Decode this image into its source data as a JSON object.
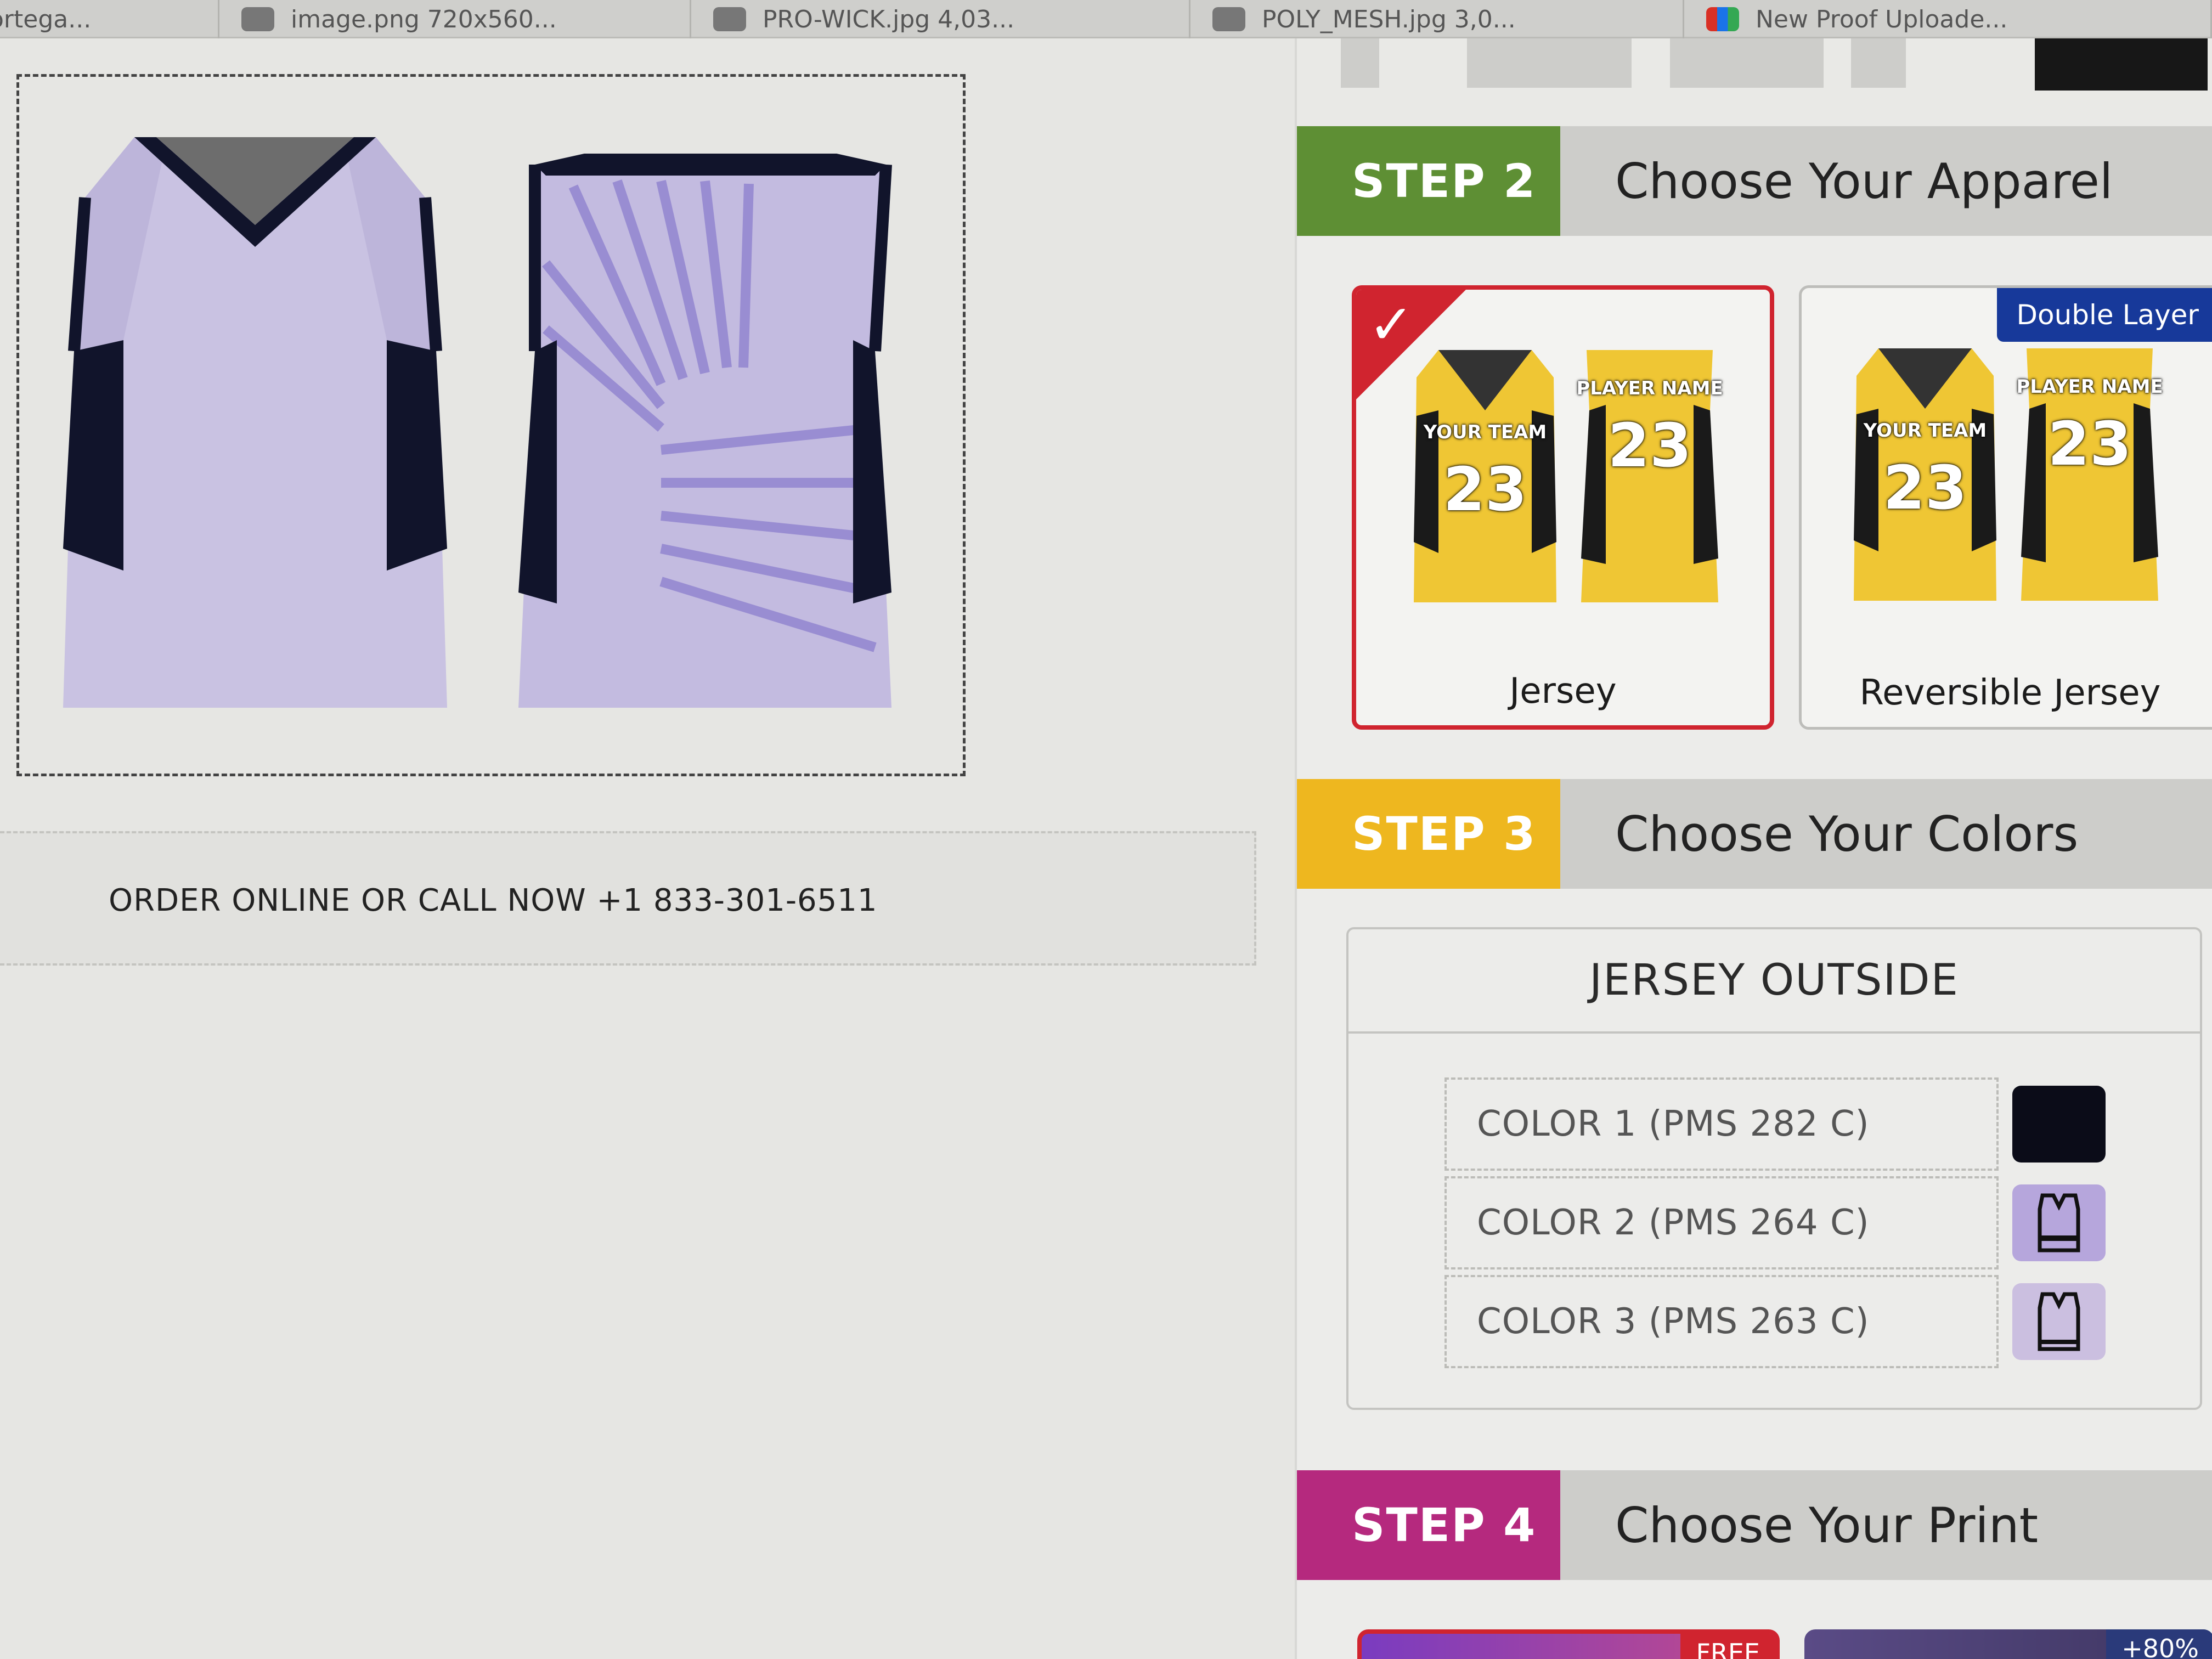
{
  "browser_tabs": [
    {
      "label": "ortega..."
    },
    {
      "label": "image.png 720x560..."
    },
    {
      "label": "PRO-WICK.jpg 4,03..."
    },
    {
      "label": "POLY_MESH.jpg 3,0..."
    },
    {
      "label": "New Proof Uploade..."
    }
  ],
  "preview": {
    "front_icon": "jersey-front",
    "back_icon": "jersey-back",
    "colors": {
      "body": "#c9c2e2",
      "trim": "#11142b",
      "stripes": "#8f82cf"
    }
  },
  "order_bar": {
    "text": "ORDER ONLINE OR CALL NOW +1 833-301-6511"
  },
  "steps": {
    "step2": {
      "badge": "STEP 2",
      "title": "Choose Your Apparel",
      "color": "#5e8f34"
    },
    "step3": {
      "badge": "STEP 3",
      "title": "Choose Your Colors",
      "color": "#eeb71f"
    },
    "step4": {
      "badge": "STEP 4",
      "title": "Choose Your Print",
      "color": "#b5297e"
    }
  },
  "apparel": [
    {
      "label": "Jersey",
      "selected": true,
      "front_text": "YOUR TEAM",
      "back_text": "PLAYER NAME",
      "number": "23"
    },
    {
      "label": "Reversible Jersey",
      "selected": false,
      "badge": "Double Layer",
      "front_text": "YOUR TEAM",
      "back_text": "PLAYER NAME",
      "number": "23"
    }
  ],
  "colors_section": {
    "title": "JERSEY OUTSIDE",
    "rows": [
      {
        "label": "COLOR 1 (PMS 282 C)",
        "hex": "#0b0c18",
        "icon": "solid-swatch"
      },
      {
        "label": "COLOR 2 (PMS 264 C)",
        "hex": "#b6a6dc",
        "icon": "jersey-swatch-icon"
      },
      {
        "label": "COLOR 3 (PMS 263 C)",
        "hex": "#cbbfe0",
        "icon": "jersey-swatch-icon"
      }
    ]
  },
  "print_cards": [
    {
      "tag": "FREE"
    },
    {
      "tag": "+80%"
    }
  ]
}
